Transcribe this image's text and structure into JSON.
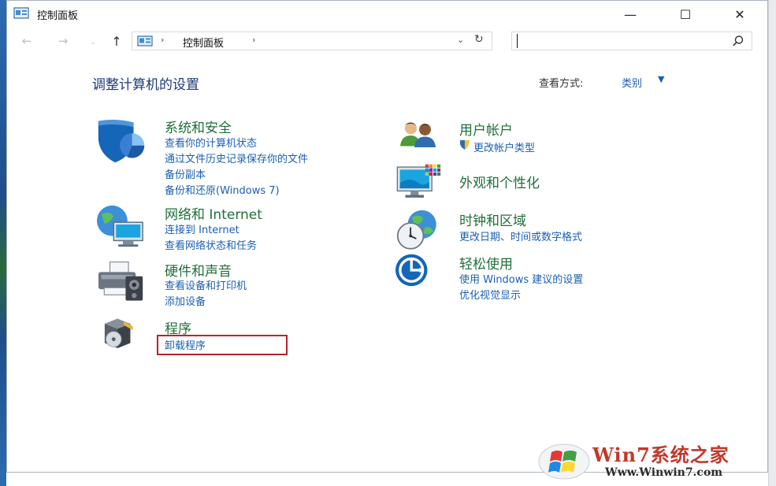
{
  "window": {
    "title": "控制面板",
    "minimize_glyph": "—",
    "maximize_glyph": "☐",
    "close_glyph": "✕"
  },
  "navbar": {
    "back_glyph": "←",
    "forward_glyph": "→",
    "recent_glyph": "⌄",
    "up_glyph": "↑",
    "address_separator": "›",
    "address_path": "控制面板",
    "address_trailing_separator": "›",
    "dropdown_glyph": "⌄",
    "refresh_glyph": "↻",
    "search_value": "",
    "search_placeholder": ""
  },
  "content": {
    "heading": "调整计算机的设置",
    "view_label": "查看方式:",
    "view_value": "类别",
    "view_caret": "▼"
  },
  "categories": [
    {
      "title": "系统和安全",
      "icon": "security-shield-icon",
      "links": [
        "查看你的计算机状态",
        "通过文件历史记录保存你的文件",
        "备份副本",
        "备份和还原(Windows 7)"
      ]
    },
    {
      "title": "网络和 Internet",
      "icon": "network-globe-icon",
      "links": [
        "连接到 Internet",
        "查看网络状态和任务"
      ]
    },
    {
      "title": "硬件和声音",
      "icon": "printer-hardware-icon",
      "links": [
        "查看设备和打印机",
        "添加设备"
      ]
    },
    {
      "title": "程序",
      "icon": "programs-disc-icon",
      "links": [
        "卸载程序"
      ]
    },
    {
      "title": "用户帐户",
      "icon": "user-accounts-icon",
      "links": [
        "更改帐户类型"
      ]
    },
    {
      "title": "外观和个性化",
      "icon": "appearance-monitor-icon",
      "links": []
    },
    {
      "title": "时钟和区域",
      "icon": "clock-region-icon",
      "links": [
        "更改日期、时间或数字格式"
      ]
    },
    {
      "title": "轻松使用",
      "icon": "ease-of-access-icon",
      "links": [
        "使用 Windows 建议的设置",
        "优化视觉显示"
      ]
    }
  ],
  "watermark": {
    "title": "Win7系统之家",
    "url": "Www.Winwin7.com"
  },
  "colors": {
    "category_title": "#1f6f3a",
    "link": "#1a5fb4",
    "heading": "#1e3a78",
    "highlight": "#b3262b"
  }
}
